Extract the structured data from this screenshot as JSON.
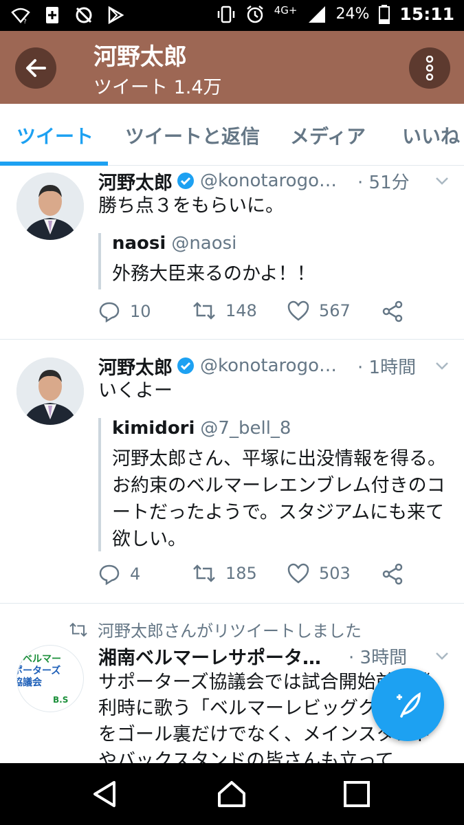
{
  "status_bar": {
    "network": "4G+",
    "battery": "24%",
    "time": "15:11"
  },
  "header": {
    "title": "河野太郎",
    "subtitle": "ツイート 1.4万"
  },
  "tabs": [
    {
      "label": "ツイート",
      "active": true
    },
    {
      "label": "ツイートと返信",
      "active": false
    },
    {
      "label": "メディア",
      "active": false
    },
    {
      "label": "いいね",
      "active": false
    }
  ],
  "tweets": [
    {
      "name": "河野太郎",
      "handle": "@konotarogoma...",
      "time": "· 51分",
      "text": "勝ち点３をもらいに。",
      "quote": {
        "name": "naosi",
        "handle": "@naosi",
        "text": "外務大臣来るのかよ！！"
      },
      "replies": "10",
      "retweets": "148",
      "likes": "567"
    },
    {
      "name": "河野太郎",
      "handle": "@konotarogom...",
      "time": "· 1時間",
      "text": "いくよー",
      "quote": {
        "name": "kimidori",
        "handle": "@7_bell_8",
        "text": "河野太郎さん、平塚に出没情報を得る。お約束のベルマーレエンブレム付きのコートだったようで。スタジアムにも来て欲しい。"
      },
      "replies": "4",
      "retweets": "185",
      "likes": "503"
    },
    {
      "retweeted_by": "河野太郎さんがリツイートしました",
      "name": "湘南ベルマーレサポーター...",
      "time": "· 3時間",
      "avatar_text_1": "南ベルマー",
      "avatar_text_2": "ポーターズ",
      "avatar_text_3": "協議会",
      "avatar_text_4": "B.S",
      "text": "サポーターズ協議会では試合開始前と勝利時に歌う「ベルマーレビッグクラブ」をゴール裏だけでなく、メインスタンドやバックスタンドの皆さんも立って"
    }
  ],
  "colors": {
    "header_bg": "#9d6754",
    "accent": "#1da1f2",
    "secondary_text": "#657786"
  }
}
